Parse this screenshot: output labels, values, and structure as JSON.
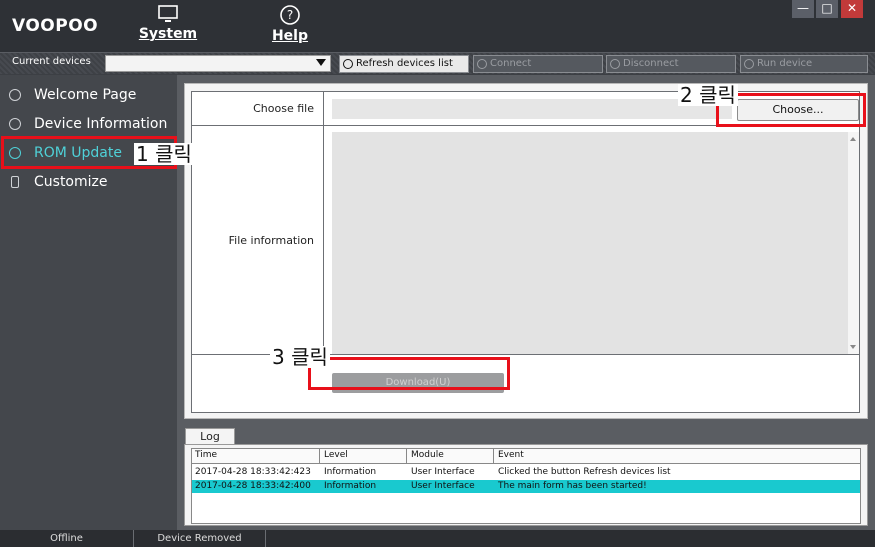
{
  "app": {
    "logo": "VOOPOO"
  },
  "menu": {
    "system": "System",
    "help": "Help"
  },
  "window_controls": {
    "minimize": "—",
    "maximize": "□",
    "close": "✕"
  },
  "device_bar": {
    "label": "Current devices",
    "selected_device": "",
    "refresh": "Refresh devices list",
    "connect": "Connect",
    "disconnect": "Disconnect",
    "run": "Run device"
  },
  "sidebar": {
    "items": [
      {
        "label": "Welcome Page",
        "icon": "smile-icon"
      },
      {
        "label": "Device Information",
        "icon": "gear-icon"
      },
      {
        "label": "ROM Update",
        "icon": "gear-icon",
        "active": true
      },
      {
        "label": "Customize",
        "icon": "bulb-icon"
      }
    ]
  },
  "rom_update": {
    "choose_file_label": "Choose file",
    "file_path": "",
    "choose_button": "Choose...",
    "file_info_label": "File information",
    "download_button": "Download(U)"
  },
  "log": {
    "tab": "Log",
    "columns": [
      "Time",
      "Level",
      "Module",
      "Event"
    ],
    "rows": [
      [
        "2017-04-28 18:33:42:423",
        "Information",
        "User Interface",
        "Clicked the button Refresh devices list"
      ],
      [
        "2017-04-28 18:33:42:400",
        "Information",
        "User Interface",
        "The main form has been started!"
      ]
    ]
  },
  "status": {
    "connection": "Offline",
    "event": "Device Removed"
  },
  "annotations": {
    "step1": "1 클릭",
    "step2": "2 클릭",
    "step3": "3 클릭"
  },
  "colors": {
    "accent": "#19c9cf",
    "highlight": "#e8101a",
    "sidebar_active": "#4fd1d8"
  }
}
